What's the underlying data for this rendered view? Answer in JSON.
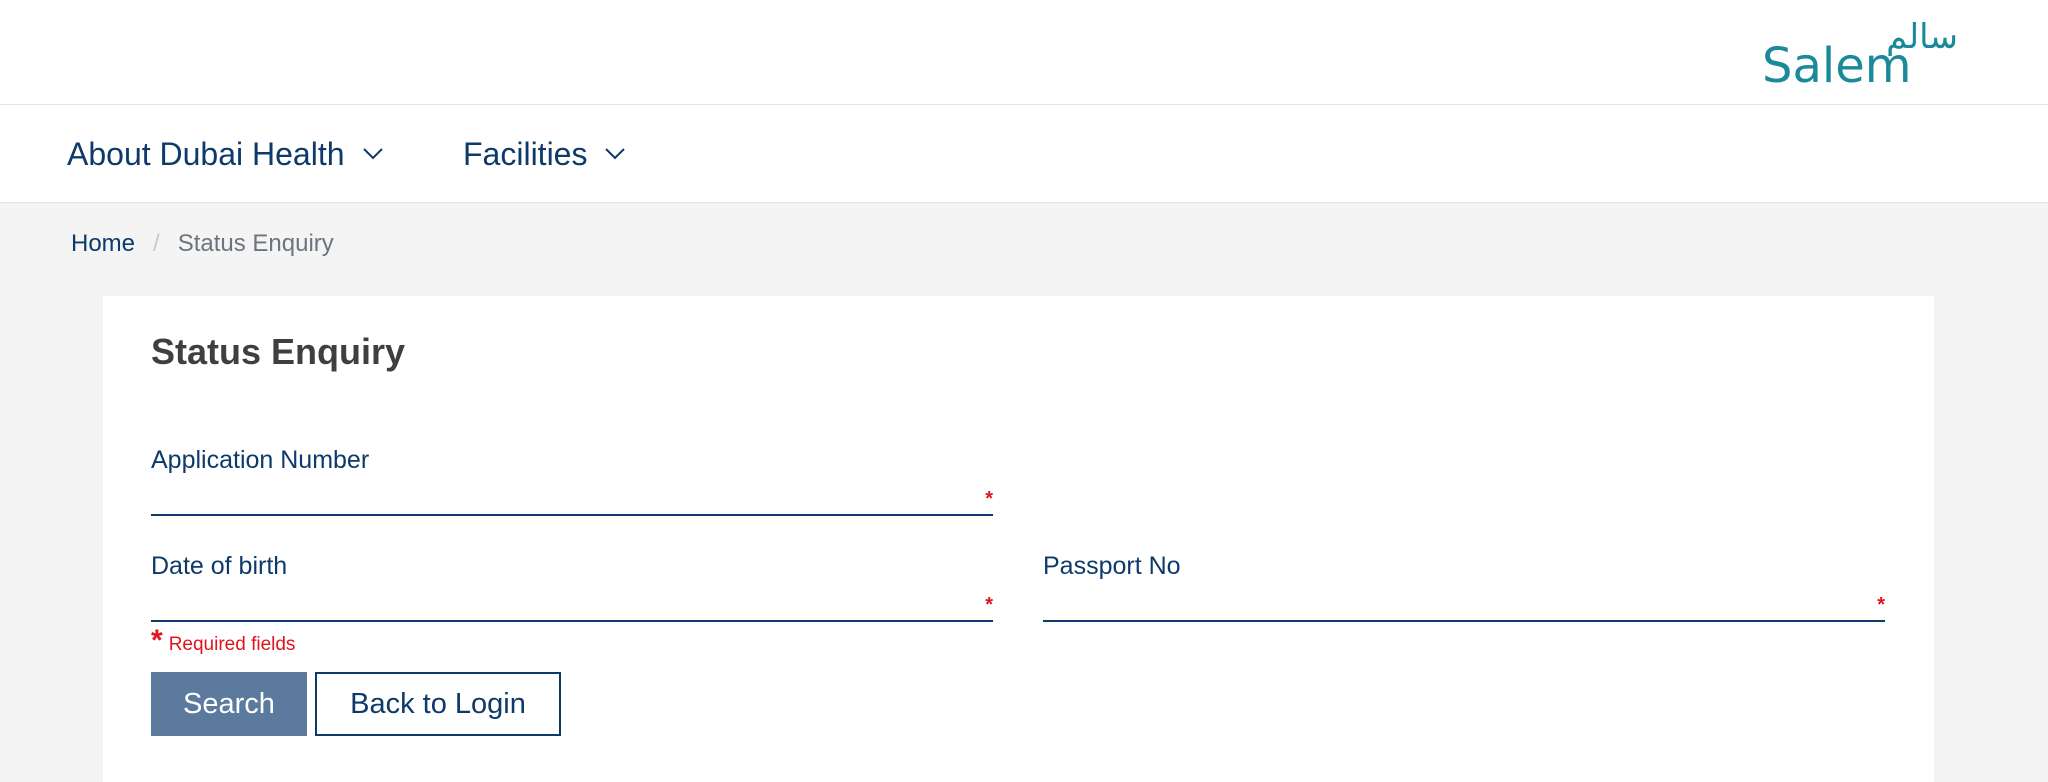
{
  "brand": {
    "logo_text": "Salem",
    "logo_arabic": "سالم",
    "colors": {
      "logo": "#1a8a9b",
      "primary": "#0d3a6a",
      "required": "#e0141e",
      "search_button": "#5b7a9d"
    }
  },
  "nav": {
    "items": [
      {
        "label": "About Dubai Health",
        "icon": "chevron-down-icon"
      },
      {
        "label": "Facilities",
        "icon": "chevron-down-icon"
      }
    ]
  },
  "breadcrumb": {
    "home": "Home",
    "separator": "/",
    "current": "Status Enquiry"
  },
  "form": {
    "title": "Status Enquiry",
    "fields": {
      "application_number": {
        "label": "Application Number",
        "value": "",
        "required_mark": "*"
      },
      "date_of_birth": {
        "label": "Date of birth",
        "value": "",
        "required_mark": "*"
      },
      "passport_no": {
        "label": "Passport No",
        "value": "",
        "required_mark": "*"
      }
    },
    "required_note": {
      "star": "*",
      "text": "Required fields"
    },
    "buttons": {
      "search": "Search",
      "back_to_login": "Back to Login"
    }
  }
}
